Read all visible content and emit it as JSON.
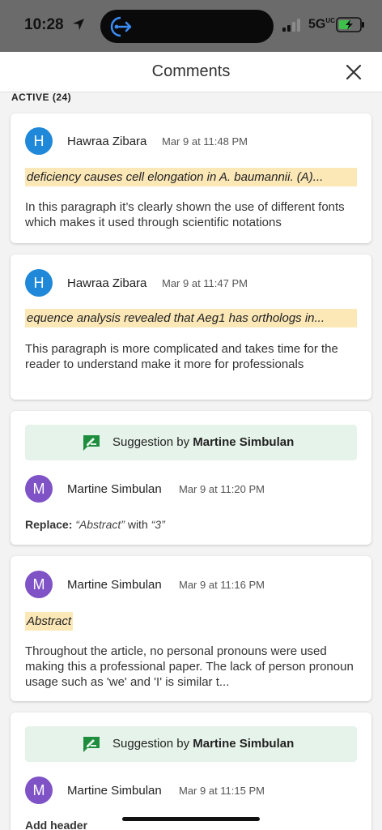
{
  "status_bar": {
    "time": "10:28",
    "network": "5G",
    "network_sup": "UC"
  },
  "header": {
    "title": "Comments"
  },
  "section": {
    "label": "ACTIVE (24)"
  },
  "comments": [
    {
      "type": "comment",
      "avatar_letter": "H",
      "author": "Hawraa Zibara",
      "time": "Mar 9 at 11:48 PM",
      "quote": "deficiency causes cell elongation in A. baumannii. (A)...",
      "text": "In this paragraph it’s clearly shown the use of different fonts which makes it used through scientific notations"
    },
    {
      "type": "comment",
      "avatar_letter": "H",
      "author": "Hawraa Zibara",
      "time": "Mar 9 at 11:47 PM",
      "quote": "equence analysis revealed that Aeg1 has orthologs in...",
      "text": "This paragraph is more complicated and takes time for the reader to understand make it more for professionals"
    },
    {
      "type": "suggestion",
      "suggestion_prefix": "Suggestion by",
      "suggestion_author": "Martine Simbulan",
      "avatar_letter": "M",
      "author": "Martine Simbulan",
      "time": "Mar 9 at 11:20 PM",
      "replace_label": "Replace:",
      "replace_from": "“Abstract”",
      "replace_with_word": "with",
      "replace_to": "“3”"
    },
    {
      "type": "comment",
      "avatar_letter": "M",
      "author": "Martine Simbulan",
      "time": "Mar 9 at 11:16 PM",
      "quote": "Abstract",
      "text": "Throughout the article, no personal pronouns were used making this a professional paper. The lack of person pronoun usage such as 'we' and 'I' is similar t..."
    },
    {
      "type": "suggestion",
      "suggestion_prefix": "Suggestion by",
      "suggestion_author": "Martine Simbulan",
      "avatar_letter": "M",
      "author": "Martine Simbulan",
      "time": "Mar 9 at 11:15 PM",
      "partial_text": "Add header"
    }
  ],
  "colors": {
    "highlight": "#fce8b6",
    "suggestion_bg": "#e6f3ea",
    "suggestion_icon": "#1e8e3e",
    "avatar_blue": "#1f88d8",
    "avatar_purple": "#7f52c6"
  },
  "icons": [
    "location-arrow-icon",
    "screen-share-icon",
    "signal-icon",
    "battery-charging-icon",
    "close-icon",
    "suggestion-icon"
  ]
}
